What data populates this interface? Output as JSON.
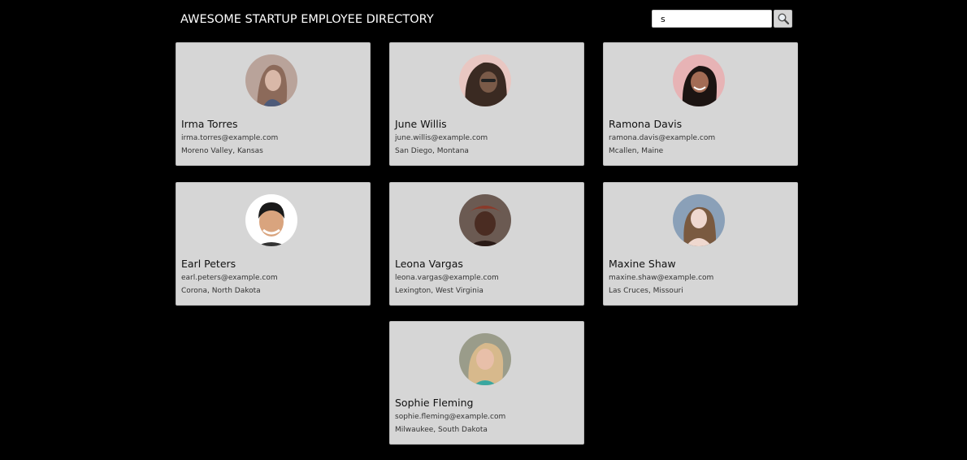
{
  "header": {
    "title": "AWESOME STARTUP EMPLOYEE DIRECTORY"
  },
  "search": {
    "value": "s",
    "button_icon": "magnifier-icon"
  },
  "employees": [
    {
      "name": "Irma Torres",
      "email": "irma.torres@example.com",
      "location": "Moreno Valley, Kansas",
      "avatar_colors": [
        "#b9a39a",
        "#8c6a5a",
        "#d9b8a8"
      ]
    },
    {
      "name": "June Willis",
      "email": "june.willis@example.com",
      "location": "San Diego, Montana",
      "avatar_colors": [
        "#e9c7c2",
        "#3a2a22",
        "#7a5a48"
      ]
    },
    {
      "name": "Ramona Davis",
      "email": "ramona.davis@example.com",
      "location": "Mcallen, Maine",
      "avatar_colors": [
        "#e7b3b5",
        "#1c1412",
        "#a36c55"
      ]
    },
    {
      "name": "Earl Peters",
      "email": "earl.peters@example.com",
      "location": "Corona, North Dakota",
      "avatar_colors": [
        "#ffffff",
        "#1a1a1a",
        "#d9a47e"
      ]
    },
    {
      "name": "Leona Vargas",
      "email": "leona.vargas@example.com",
      "location": "Lexington, West Virginia",
      "avatar_colors": [
        "#6b5a52",
        "#4a2c22",
        "#8a3a2a"
      ]
    },
    {
      "name": "Maxine Shaw",
      "email": "maxine.shaw@example.com",
      "location": "Las Cruces, Missouri",
      "avatar_colors": [
        "#8aa0b8",
        "#7a5a40",
        "#efd8cf"
      ]
    },
    {
      "name": "Sophie Fleming",
      "email": "sophie.fleming@example.com",
      "location": "Milwaukee, South Dakota",
      "avatar_colors": [
        "#9a9c8a",
        "#d7b98c",
        "#e8bfa9"
      ]
    }
  ]
}
